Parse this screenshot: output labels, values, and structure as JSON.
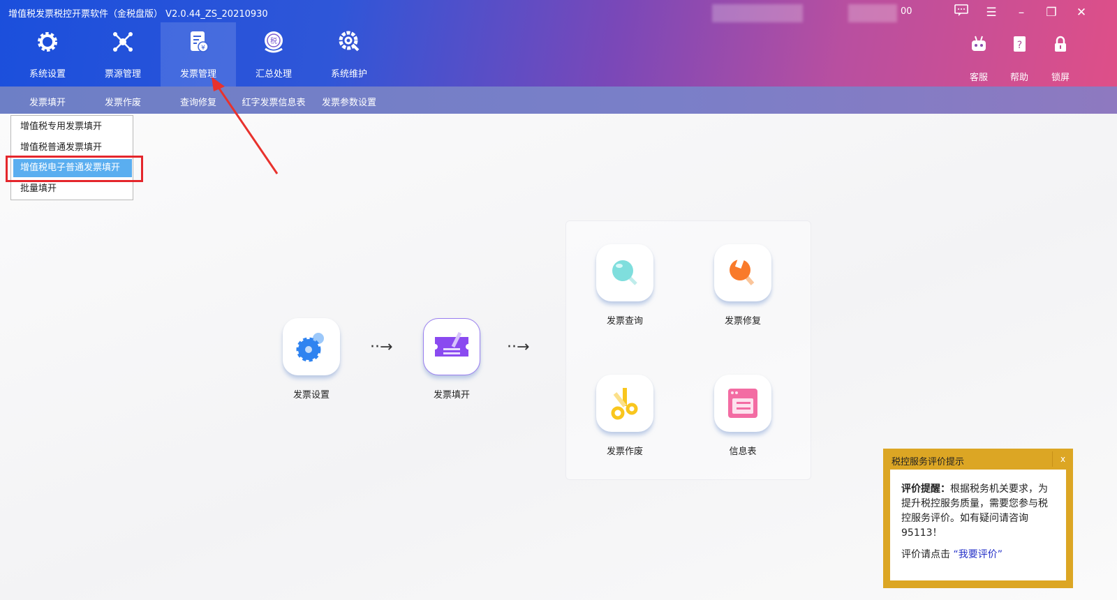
{
  "window": {
    "title": "增值税发票税控开票软件（金税盘版）  V2.0.44_ZS_20210930",
    "partial_text": "00"
  },
  "main_nav": [
    {
      "label": "系统设置",
      "icon": "gear-icon"
    },
    {
      "label": "票源管理",
      "icon": "network-icon"
    },
    {
      "label": "发票管理",
      "icon": "invoice-icon",
      "active": true
    },
    {
      "label": "汇总处理",
      "icon": "tax-summary-icon"
    },
    {
      "label": "系统维护",
      "icon": "maintenance-icon"
    }
  ],
  "right_nav": [
    {
      "label": "客服",
      "icon": "robot-icon"
    },
    {
      "label": "帮助",
      "icon": "help-icon"
    },
    {
      "label": "锁屏",
      "icon": "lock-icon"
    }
  ],
  "sub_nav": [
    "发票填开",
    "发票作废",
    "查询修复",
    "红字发票信息表",
    "发票参数设置"
  ],
  "dropdown": {
    "items": [
      "增值税专用发票填开",
      "增值税普通发票填开",
      "增值税电子普通发票填开",
      "批量填开"
    ],
    "selected_index": 2
  },
  "flow": [
    {
      "label": "发票设置",
      "icon": "gear-settings-icon"
    },
    {
      "label": "发票填开",
      "icon": "invoice-fill-icon"
    }
  ],
  "panel": [
    {
      "label": "发票查询",
      "icon": "magnifier-icon"
    },
    {
      "label": "发票修复",
      "icon": "wrench-icon"
    },
    {
      "label": "发票作废",
      "icon": "scissors-icon"
    },
    {
      "label": "信息表",
      "icon": "info-table-icon"
    }
  ],
  "popup": {
    "title": "税控服务评价提示",
    "close": "x",
    "bold": "评价提醒：",
    "body": "根据税务机关要求，为提升税控服务质量，需要您参与税控服务评价。如有疑问请咨询95113！",
    "prompt": "评价请点击",
    "link": "“我要评价”"
  },
  "colors": {
    "selected": "#5aaef0",
    "highlight_box": "#e4262c",
    "popup": "#dca624"
  }
}
